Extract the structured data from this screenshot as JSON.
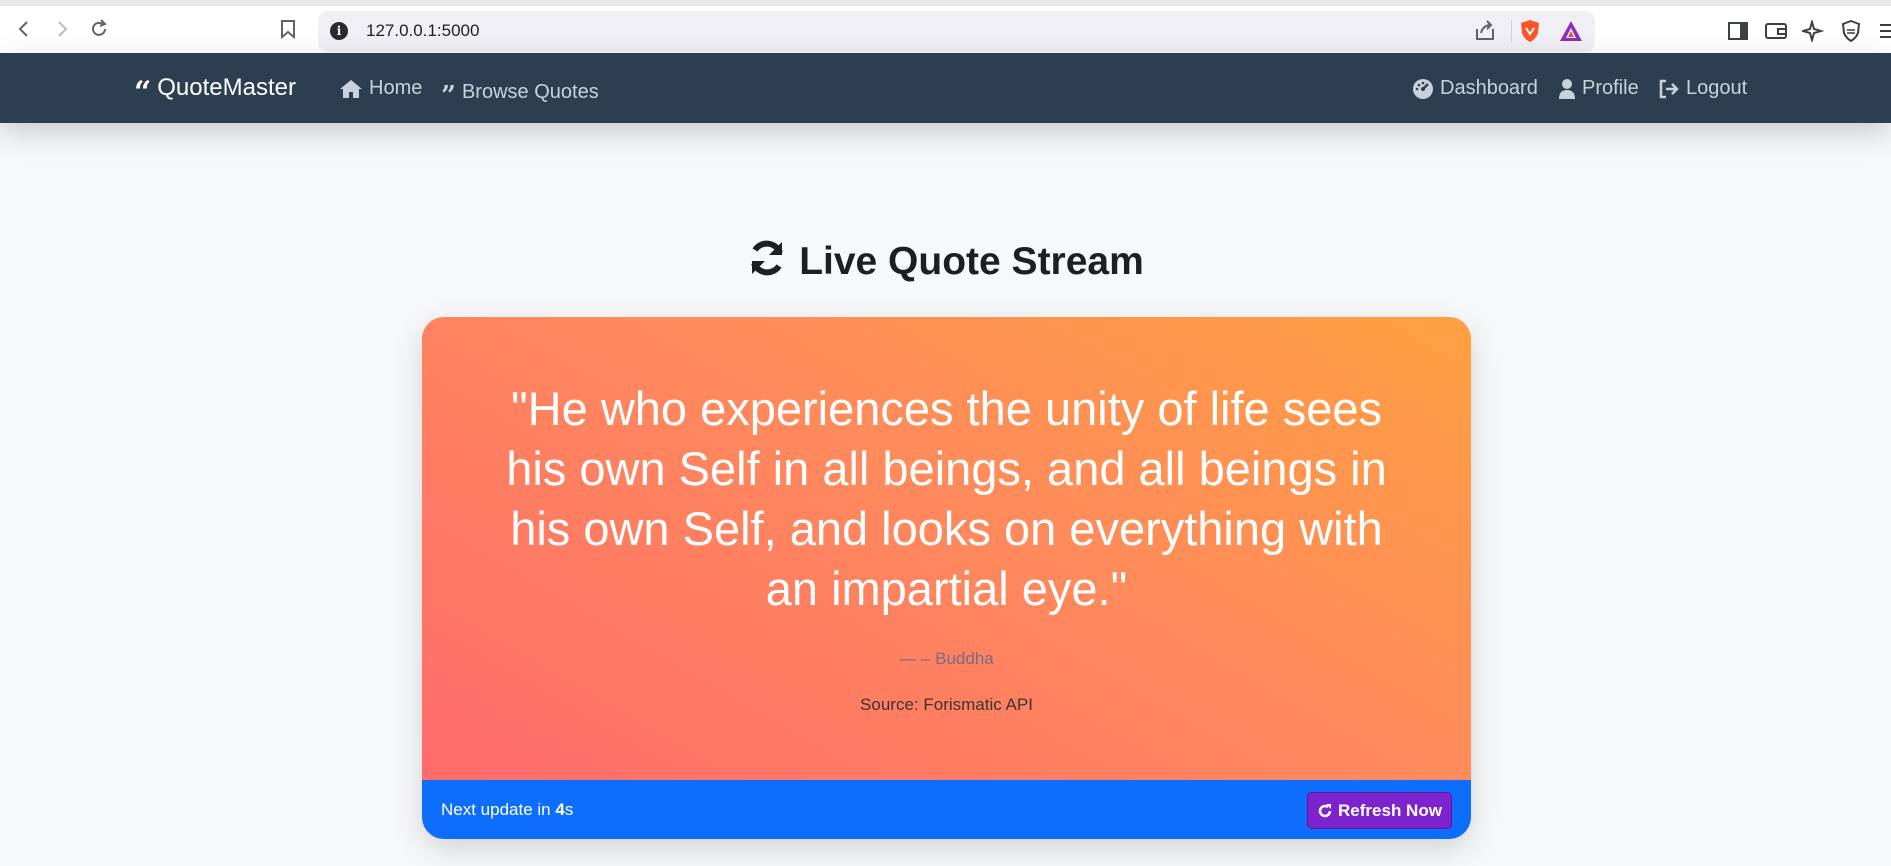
{
  "browser": {
    "url": "127.0.0.1:5000",
    "icons": [
      "back-icon",
      "forward-icon",
      "reload-icon",
      "bookmark-icon",
      "site-info-icon",
      "share-icon",
      "brave-shields-icon",
      "brave-rewards-icon",
      "sidebar-icon",
      "wallet-icon",
      "leo-ai-icon",
      "vpn-icon",
      "menu-icon"
    ]
  },
  "navbar": {
    "brand": "QuoteMaster",
    "links_left": [
      {
        "label": "Home",
        "icon": "home-icon"
      },
      {
        "label": "Browse Quotes",
        "icon": "quote-icon"
      }
    ],
    "links_right": [
      {
        "label": "Dashboard",
        "icon": "dashboard-icon"
      },
      {
        "label": "Profile",
        "icon": "user-icon"
      },
      {
        "label": "Logout",
        "icon": "logout-icon"
      }
    ],
    "background": "#2c3e50"
  },
  "main": {
    "heading": "Live Quote Stream",
    "quote": {
      "text": "\"He who experiences the unity of life sees his own Self in all beings, and all beings in his own Self, and looks on everything with an impartial eye.\"",
      "author": "— – Buddha",
      "source": "Source: Forismatic API"
    },
    "footer": {
      "next_update_prefix": "Next update in ",
      "countdown": "4",
      "countdown_unit": "s",
      "refresh_label": "Refresh Now"
    }
  },
  "colors": {
    "gradient_start": "#ff6b6b",
    "gradient_end": "#ffa041",
    "footer_bg": "#0d6efd",
    "refresh_button": "#7e22ce"
  }
}
